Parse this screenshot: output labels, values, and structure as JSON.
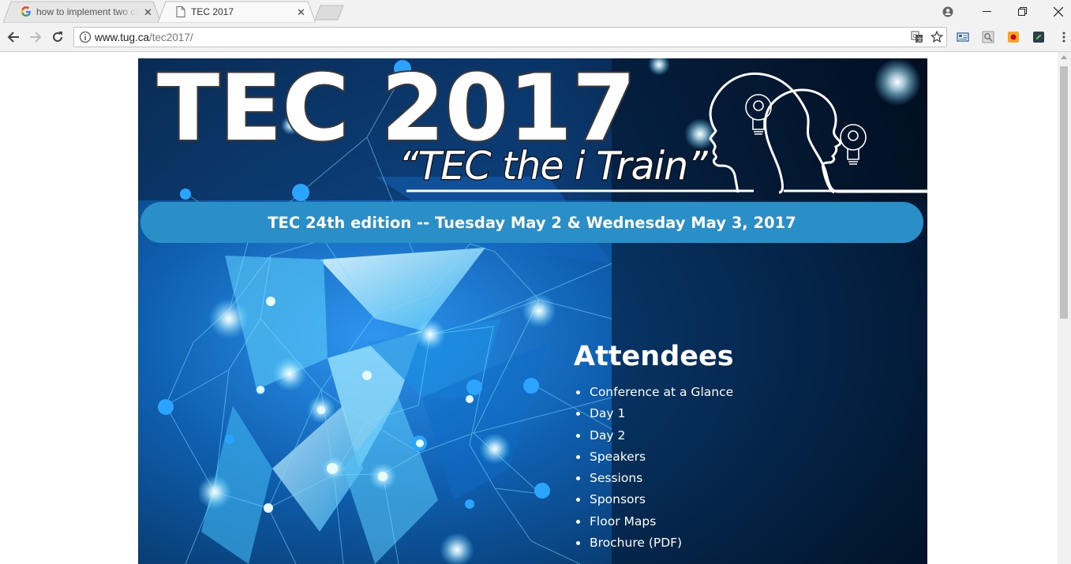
{
  "browser": {
    "tabs": [
      {
        "title": "how to implement two column",
        "active": false
      },
      {
        "title": "TEC 2017",
        "active": true
      }
    ],
    "address": {
      "domain": "www.tug.ca",
      "path": "/tec2017/"
    },
    "window_controls": [
      "minimize",
      "restore",
      "close"
    ]
  },
  "banner": {
    "title": "TEC 2017",
    "slogan": "“TEC the i Train”",
    "edition": "TEC 24th edition -- Tuesday May 2 & Wednesday May 3, 2017"
  },
  "attendees": {
    "heading": "Attendees",
    "items": [
      {
        "label": "Conference at a Glance"
      },
      {
        "label": "Day 1"
      },
      {
        "label": "Day 2"
      },
      {
        "label": "Speakers"
      },
      {
        "label": "Sessions"
      },
      {
        "label": "Sponsors"
      },
      {
        "label": "Floor Maps"
      },
      {
        "label": "Brochure (PDF)"
      }
    ]
  },
  "colors": {
    "chrome_bg": "#f2f2f2",
    "banner_dark": "#041a33",
    "banner_blue": "#1f78c8",
    "edition_bar": "#2a8fc6",
    "text": "#ffffff"
  },
  "icons": [
    "google-favicon",
    "page-favicon",
    "close-icon",
    "profile-icon",
    "back-icon",
    "forward-icon",
    "reload-icon",
    "info-icon",
    "translate-icon",
    "bookmark-star-icon",
    "extension-icon",
    "menu-icon"
  ]
}
